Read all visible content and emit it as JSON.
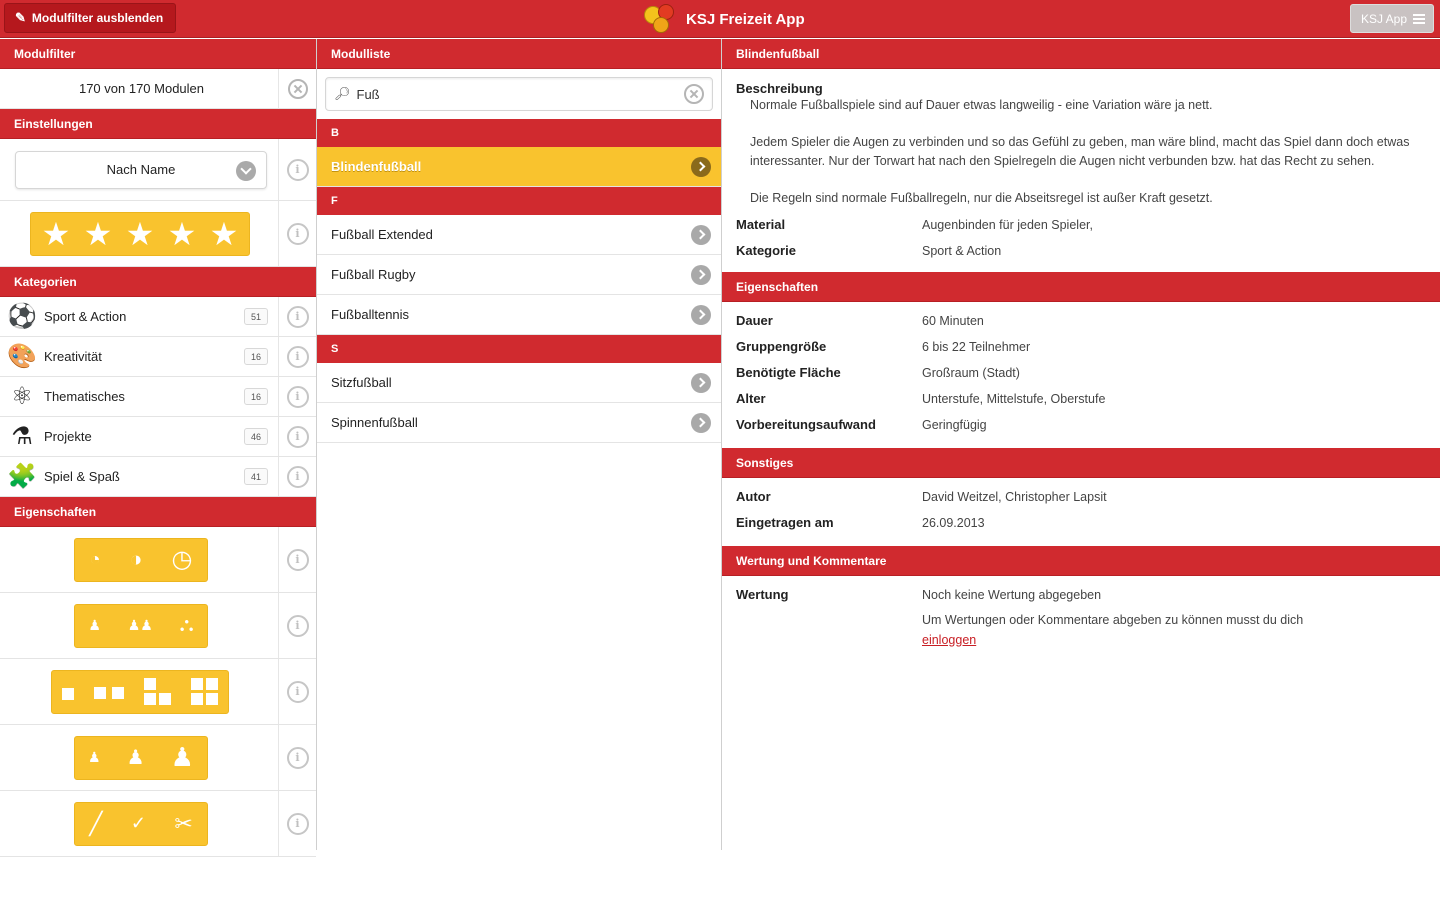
{
  "topbar": {
    "filter_button": "Modulfilter ausblenden",
    "title": "KSJ Freizeit App",
    "menu_button": "KSJ App"
  },
  "filter": {
    "header": "Modulfilter",
    "count_text": "170 von 170 Modulen",
    "settings_header": "Einstellungen",
    "sort_value": "Nach Name",
    "rating_stars": 5,
    "categories_header": "Kategorien",
    "categories": [
      {
        "label": "Sport & Action",
        "count": "51",
        "icon": "soccer-ball-icon"
      },
      {
        "label": "Kreativität",
        "count": "16",
        "icon": "palette-icon"
      },
      {
        "label": "Thematisches",
        "count": "16",
        "icon": "atom-icon"
      },
      {
        "label": "Projekte",
        "count": "46",
        "icon": "flask-icon"
      },
      {
        "label": "Spiel & Spaß",
        "count": "41",
        "icon": "puzzle-icon"
      }
    ],
    "properties_header": "Eigenschaften"
  },
  "list": {
    "header": "Modulliste",
    "search_value": "Fuß",
    "groups": [
      {
        "letter": "B",
        "items": [
          "Blindenfußball"
        ]
      },
      {
        "letter": "F",
        "items": [
          "Fußball Extended",
          "Fußball Rugby",
          "Fußballtennis"
        ]
      },
      {
        "letter": "S",
        "items": [
          "Sitzfußball",
          "Spinnenfußball"
        ]
      }
    ],
    "active_item": "Blindenfußball"
  },
  "detail": {
    "header": "Blindenfußball",
    "description_label": "Beschreibung",
    "description": [
      "Normale Fußballspiele sind auf Dauer etwas langweilig - eine Variation wäre ja nett.",
      "Jedem Spieler die Augen zu verbinden und so das Gefühl zu geben, man wäre blind, macht das Spiel dann doch etwas interessanter. Nur der Torwart hat nach den Spielregeln die Augen nicht verbunden bzw. hat das Recht zu sehen.",
      "Die Regeln sind normale Fußballregeln, nur die Abseitsregel ist außer Kraft gesetzt."
    ],
    "material_label": "Material",
    "material": "Augenbinden für jeden Spieler,",
    "category_label": "Kategorie",
    "category": "Sport & Action",
    "properties_header": "Eigenschaften",
    "properties": [
      {
        "k": "Dauer",
        "v": "60 Minuten"
      },
      {
        "k": "Gruppengröße",
        "v": "6 bis 22 Teilnehmer"
      },
      {
        "k": "Benötigte Fläche",
        "v": "Großraum (Stadt)"
      },
      {
        "k": "Alter",
        "v": "Unterstufe, Mittelstufe, Oberstufe"
      },
      {
        "k": "Vorbereitungsaufwand",
        "v": "Geringfügig"
      }
    ],
    "misc_header": "Sonstiges",
    "misc": [
      {
        "k": "Autor",
        "v": "David Weitzel, Christopher Lapsit"
      },
      {
        "k": "Eingetragen am",
        "v": "26.09.2013"
      }
    ],
    "rating_header": "Wertung und Kommentare",
    "rating_label": "Wertung",
    "rating_value": "Noch keine Wertung abgegeben",
    "rating_hint": "Um Wertungen oder Kommentare abgeben zu können musst du dich",
    "login_link": "einloggen"
  },
  "colors": {
    "primary": "#d02a2f",
    "accent": "#f9c32e"
  }
}
